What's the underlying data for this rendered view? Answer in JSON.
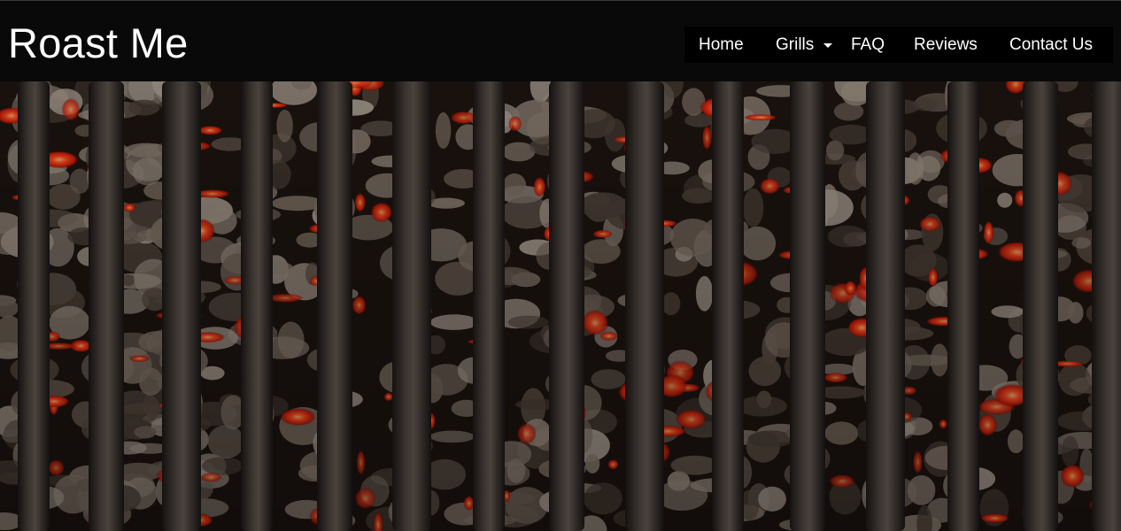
{
  "site": {
    "title": "Roast Me"
  },
  "nav": {
    "items": [
      {
        "label": "Home"
      },
      {
        "label": "Grills",
        "has_dropdown": true,
        "icon": "caret-down-icon"
      },
      {
        "label": "FAQ"
      },
      {
        "label": "Reviews"
      },
      {
        "label": "Contact Us"
      }
    ]
  },
  "hero": {
    "image_subject": "charcoal-grill-grate-photo"
  },
  "colors": {
    "header_bg": "#090909",
    "nav_bg": "#000000",
    "text": "#ffffff",
    "ember": "#ff3a1a",
    "ash": "#8a7a6c",
    "grate": "#2a2522"
  }
}
